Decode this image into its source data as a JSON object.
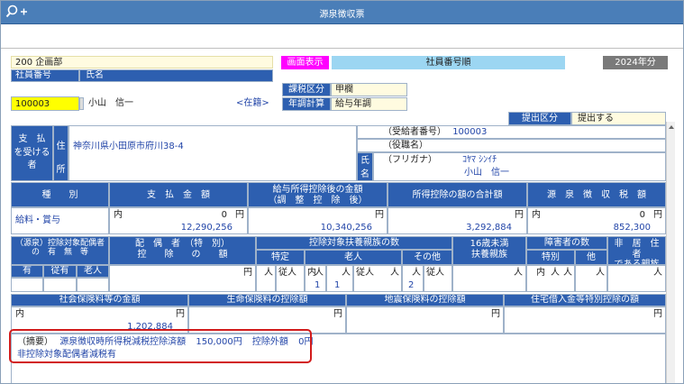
{
  "window": {
    "title": "源泉徴収票"
  },
  "header": {
    "dept": "200 企画部",
    "display_button": "画面表示",
    "sort": "社員番号順",
    "year": "2024年分",
    "emp_no_label": "社員番号",
    "name_label": "氏名",
    "emp_no": "100003",
    "name": "小山　信一",
    "status": "<在籍>",
    "tax_cat_label": "課税区分",
    "tax_cat": "甲欄",
    "year_end_label": "年調計算",
    "year_end": "給与年調",
    "submit_label": "提出区分",
    "submit": "提出する"
  },
  "recipient": {
    "label_pay": "支　払",
    "label_recv": "を受ける",
    "label_person": "者",
    "label_addr1": "住",
    "label_addr2": "所",
    "address": "神奈川県小田原市府川38-4",
    "recipient_no_label": "（受給者番号）",
    "recipient_no": "100003",
    "role_label": "（役職名）",
    "name_label1": "氏",
    "name_label2": "名",
    "furigana_label": "（フリガナ）",
    "furigana": "ｺﾔﾏ ｼﾝｲﾁ",
    "name": "小山　信一"
  },
  "amounts": {
    "headers": [
      "種　　別",
      "支　払　金　額",
      "給与所得控除後の金額\n（調　整　控　除　後）",
      "所得控除の額の合計額",
      "源　泉　徴　収　税　額"
    ],
    "type": "給料・賞与",
    "inner": "内",
    "yen": "円",
    "zero": "0",
    "payment": "12,290,256",
    "after_deduction": "10,340,256",
    "total_deduction": "3,292,884",
    "withholding_tax": "852,300"
  },
  "dependents": {
    "spouse_header": "（源泉）控除対象配偶者\nの　有　無　等",
    "spouse_deduction_header": "配　偶　者　（特　別）\n控　　除　　の　　額",
    "dependents_header": "控除対象扶養親族の数",
    "under16_header": "16歳未満\n扶養親族",
    "disabled_header": "障害者の数",
    "nonresident_header": "非　居　住　者\nである親族",
    "col_yes": "有",
    "col_jyu": "従有",
    "col_old": "老人",
    "tokutei": "特定",
    "rojin": "老人",
    "sonota": "その他",
    "tokubetsu": "特別",
    "ta": "他",
    "uchi": "内",
    "jyujin": "従人",
    "hito": "人",
    "yen": "円",
    "v_rojin_uchi": "1",
    "v_rojin": "1",
    "v_sonota": "2"
  },
  "insurance": {
    "social": "社会保険料等の金額",
    "life": "生命保険料の控除額",
    "earthquake": "地震保険料の控除額",
    "housing": "住宅借入金等特別控除の額",
    "inner": "内",
    "yen": "円",
    "social_amount": "1,202,884"
  },
  "summary": {
    "label": "（摘要）",
    "line1_a": "源泉徴収時所得税減税控除済額",
    "line1_b": "150,000円",
    "line1_c": "控除外額",
    "line1_d": "0円",
    "line2": "非控除対象配偶者減税有"
  },
  "colors": {
    "header_blue": "#2d5fb0",
    "title_blue": "#4a7eb8",
    "magenta": "#ff00ff",
    "highlight": "#d21c1c"
  }
}
